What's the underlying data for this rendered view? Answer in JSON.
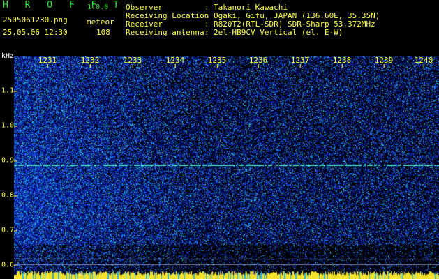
{
  "app": {
    "title": "H R O F F T",
    "version": "1.0.0"
  },
  "file": {
    "name": "2505061230.png",
    "mode": "meteor",
    "datetime": "25.05.06 12:30",
    "count": "108"
  },
  "info": [
    {
      "label": "Observer",
      "value": "Takanori Kawachi"
    },
    {
      "label": "Receiving Location",
      "value": "Ogaki, Gifu, JAPAN (136.60E, 35.35N)"
    },
    {
      "label": "Receiver",
      "value": "R820T2(RTL-SDR) SDR-Sharp 53.372MHz"
    },
    {
      "label": "Receiving antenna",
      "value": "2el-HB9CV Vertical (el. E-W)"
    }
  ],
  "axes": {
    "y_unit": "kHz",
    "x_ticks": [
      "1231",
      "1232",
      "1233",
      "1234",
      "1235",
      "1236",
      "1237",
      "1238",
      "1239",
      "1240"
    ],
    "y_ticks": [
      "1.1",
      "1.0",
      "0.9",
      "0.8",
      "0.7",
      "0.6"
    ]
  },
  "colors": {
    "background": "#000000",
    "noise_dark": "#08105a",
    "noise_mid": "#1a3dff",
    "noise_high": "#16c8e8",
    "signal_line": "#4bd6c4",
    "title_green": "#2ee82e",
    "tick_yellow": "#ffff3a",
    "bottom_bar": "#f5e22a"
  }
}
